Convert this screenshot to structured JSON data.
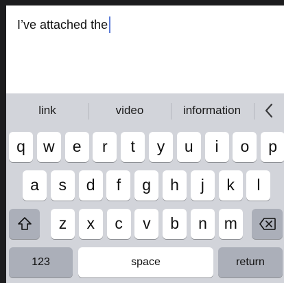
{
  "editor": {
    "text": "I’ve attached the"
  },
  "suggestions": [
    "link",
    "video",
    "information"
  ],
  "icons": {
    "collapse": "chevron-left-icon",
    "shift": "shift-icon",
    "delete": "backspace-icon"
  },
  "keyboard": {
    "row1": [
      "q",
      "w",
      "e",
      "r",
      "t",
      "y",
      "u",
      "i",
      "o",
      "p"
    ],
    "row2": [
      "a",
      "s",
      "d",
      "f",
      "g",
      "h",
      "j",
      "k",
      "l"
    ],
    "row3": [
      "z",
      "x",
      "c",
      "v",
      "b",
      "n",
      "m"
    ],
    "numbers_label": "123",
    "space_label": "space",
    "return_label": "return"
  },
  "colors": {
    "keyboard_background": "#d2d4da",
    "key": "#ffffff",
    "function_key": "#abafb9",
    "cursor": "#5b7bd6"
  }
}
